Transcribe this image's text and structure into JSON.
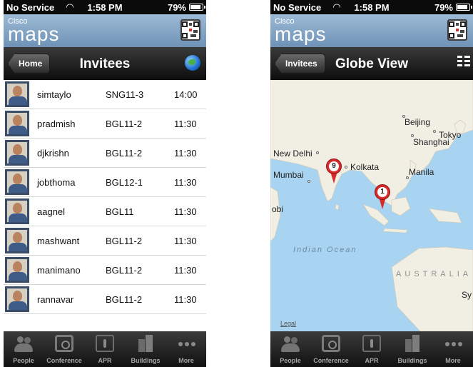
{
  "statusbar": {
    "carrier": "No Service",
    "time": "1:58 PM",
    "battery": "79%"
  },
  "brand": {
    "small": "Cisco",
    "big": "maps"
  },
  "left_screen": {
    "nav": {
      "back_label": "Home",
      "title": "Invitees",
      "right_icon": "globe-icon"
    },
    "invitees": [
      {
        "user": "simtaylo",
        "room": "SNG11-3",
        "time": "14:00",
        "status_color": "#f3a712"
      },
      {
        "user": "pradmish",
        "room": "BGL11-2",
        "time": "11:30",
        "status_color": "#f3a712"
      },
      {
        "user": "djkrishn",
        "room": "BGL11-2",
        "time": "11:30",
        "status_color": "#f3a712"
      },
      {
        "user": "jobthoma",
        "room": "BGL12-1",
        "time": "11:30",
        "status_color": "#f3a712"
      },
      {
        "user": "aagnel",
        "room": "BGL11",
        "time": "11:30",
        "status_color": "#f3a712"
      },
      {
        "user": "mashwant",
        "room": "BGL11-2",
        "time": "11:30",
        "status_color": "#f3a712"
      },
      {
        "user": "manimano",
        "room": "BGL11-2",
        "time": "11:30",
        "status_color": "#f3a712"
      },
      {
        "user": "rannavar",
        "room": "BGL11-2",
        "time": "11:30",
        "status_color": "#f3a712"
      }
    ]
  },
  "right_screen": {
    "nav": {
      "back_label": "Invitees",
      "title": "Globe View",
      "right_icon": "list-icon"
    },
    "map": {
      "cities": [
        "Beijing",
        "Tokyo",
        "Shanghai",
        "New Delhi",
        "Kolkata",
        "Mumbai",
        "Manila"
      ],
      "partial_labels": [
        "obi",
        "Sy"
      ],
      "ocean_label": "Indian Ocean",
      "country_label": "AUSTRALIA",
      "legal_label": "Legal",
      "pins": [
        {
          "count": "9"
        },
        {
          "count": "1"
        }
      ]
    }
  },
  "tabbar": {
    "items": [
      {
        "label": "People",
        "icon": "people-icon"
      },
      {
        "label": "Conference",
        "icon": "conference-icon"
      },
      {
        "label": "APR",
        "icon": "apr-icon"
      },
      {
        "label": "Buildings",
        "icon": "buildings-icon"
      },
      {
        "label": "More",
        "icon": "more-icon"
      }
    ]
  },
  "colors": {
    "accent_blue": "#6e92b6",
    "status_dot": "#f3a712",
    "pin_red": "#d72b2b",
    "map_water": "#a9d4f1"
  }
}
